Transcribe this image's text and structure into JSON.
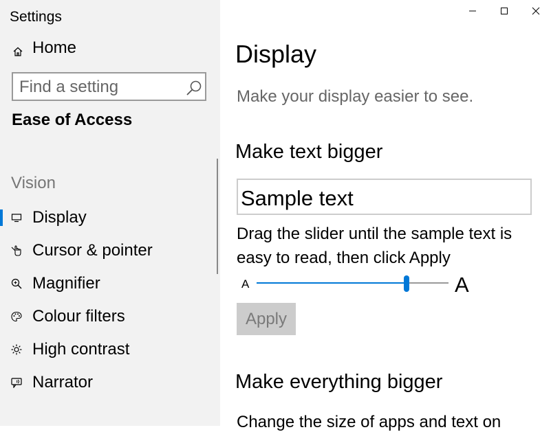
{
  "window": {
    "title": "Settings",
    "controls": [
      "minimize-icon",
      "maximize-icon",
      "close-icon"
    ]
  },
  "sidebar": {
    "home_label": "Home",
    "search": {
      "placeholder": "Find a setting",
      "value": ""
    },
    "category": "Ease of Access",
    "section_label": "Vision",
    "items": [
      {
        "label": "Display",
        "icon": "display-icon",
        "selected": true
      },
      {
        "label": "Cursor & pointer",
        "icon": "cursor-icon",
        "selected": false
      },
      {
        "label": "Magnifier",
        "icon": "magnifier-icon",
        "selected": false
      },
      {
        "label": "Colour filters",
        "icon": "palette-icon",
        "selected": false
      },
      {
        "label": "High contrast",
        "icon": "brightness-icon",
        "selected": false
      },
      {
        "label": "Narrator",
        "icon": "narrator-icon",
        "selected": false
      }
    ]
  },
  "main": {
    "title": "Display",
    "subtitle": "Make your display easier to see.",
    "text_section": {
      "heading": "Make text bigger",
      "sample": "Sample text",
      "instructions": "Drag the slider until the sample text is easy to read, then click Apply",
      "slider_small_label": "A",
      "slider_large_label": "A",
      "slider_fraction": 0.78,
      "apply_label": "Apply",
      "apply_enabled": false
    },
    "everything_section": {
      "heading": "Make everything bigger",
      "description": "Change the size of apps and text on"
    }
  },
  "colors": {
    "accent": "#0078d7",
    "sidebar_bg": "#f2f2f2",
    "disabled_button": "#cccccc"
  }
}
